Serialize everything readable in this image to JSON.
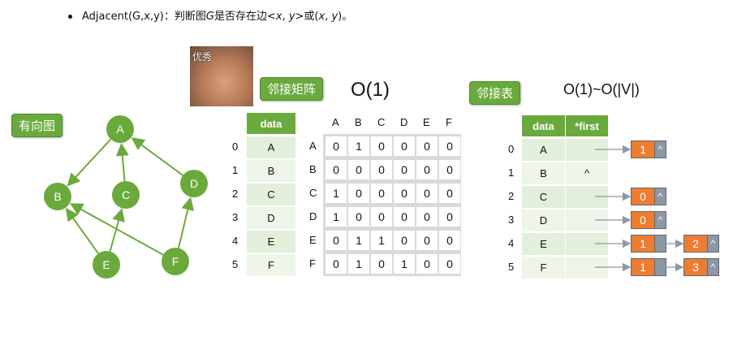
{
  "bullet": {
    "prefix": "Adjacent(G,x,y)：判断图",
    "g": "G",
    "mid": "是否存在边<",
    "x": "x",
    "comma": ", ",
    "y": "y",
    "close": ">或(",
    "x2": "x",
    "comma2": ", ",
    "y2": "y",
    "end": ")。"
  },
  "photo_caption": "优秀",
  "graph_tag": "有向图",
  "matrix_tag": "邻接矩阵",
  "list_tag": "邻接表",
  "matrix_complexity": "O(1)",
  "list_complexity": "O(1)~O(|V|)",
  "graph": {
    "nodes": [
      "A",
      "B",
      "C",
      "D",
      "E",
      "F"
    ],
    "edges": [
      [
        "A",
        "B"
      ],
      [
        "C",
        "A"
      ],
      [
        "D",
        "A"
      ],
      [
        "E",
        "B"
      ],
      [
        "E",
        "C"
      ],
      [
        "F",
        "D"
      ],
      [
        "F",
        "B"
      ]
    ]
  },
  "vertex_table": {
    "header": "data",
    "indices": [
      "0",
      "1",
      "2",
      "3",
      "4",
      "5"
    ],
    "values": [
      "A",
      "B",
      "C",
      "D",
      "E",
      "F"
    ]
  },
  "matrix": {
    "col_labels": [
      "A",
      "B",
      "C",
      "D",
      "E",
      "F"
    ],
    "row_labels": [
      "A",
      "B",
      "C",
      "D",
      "E",
      "F"
    ],
    "rows": [
      [
        "0",
        "1",
        "0",
        "0",
        "0",
        "0"
      ],
      [
        "0",
        "0",
        "0",
        "0",
        "0",
        "0"
      ],
      [
        "1",
        "0",
        "0",
        "0",
        "0",
        "0"
      ],
      [
        "1",
        "0",
        "0",
        "0",
        "0",
        "0"
      ],
      [
        "0",
        "1",
        "1",
        "0",
        "0",
        "0"
      ],
      [
        "0",
        "1",
        "0",
        "1",
        "0",
        "0"
      ]
    ]
  },
  "adj_list": {
    "headers": [
      "data",
      "*first"
    ],
    "indices": [
      "0",
      "1",
      "2",
      "3",
      "4",
      "5"
    ],
    "data": [
      "A",
      "B",
      "C",
      "D",
      "E",
      "F"
    ],
    "null_symbol": "^",
    "lists": [
      [
        "1"
      ],
      [],
      [
        "0"
      ],
      [
        "0"
      ],
      [
        "1",
        "2"
      ],
      [
        "1",
        "3"
      ]
    ]
  },
  "colors": {
    "green": "#6aaa3c",
    "light_green": "#e2efda",
    "orange": "#ed7d31",
    "grey": "#8a98a8"
  }
}
